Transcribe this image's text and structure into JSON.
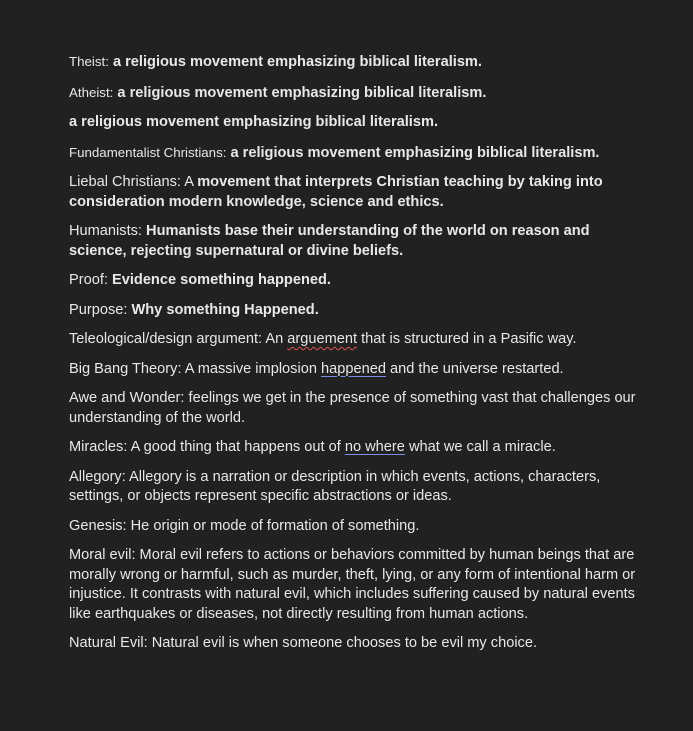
{
  "entries": [
    {
      "term": "Theist:",
      "definition": " a religious movement emphasizing biblical literalism."
    },
    {
      "term": "Atheist:",
      "definition": " a religious movement emphasizing biblical literalism."
    },
    {
      "term": "",
      "definition": "a religious movement emphasizing biblical literalism."
    },
    {
      "term": "Fundamentalist Christians:",
      "definition": " a religious movement emphasizing biblical literalism."
    },
    {
      "term": "Liebal Christians: A ",
      "definition": "movement that interprets Christian teaching by taking into consideration modern knowledge, science and ethics."
    },
    {
      "term": "Humanists: ",
      "definition": "Humanists base their understanding of the world on reason and science, rejecting supernatural or divine beliefs."
    },
    {
      "term": "Proof: ",
      "definition": "Evidence something happened."
    },
    {
      "term": "Purpose: ",
      "definition": "Why something Happened."
    },
    {
      "term": "Teleological/design argument:  An ",
      "word": "arguement",
      "rest": " that is structured in a Pasific way."
    },
    {
      "term": "Big Bang Theory: A massive implosion ",
      "word": "happened",
      "rest": " and the universe restarted."
    },
    {
      "text": "Awe and Wonder: feelings we get in the presence of something vast that challenges our understanding of the world."
    },
    {
      "term": "Miracles: A good thing that happens out of ",
      "word": "no where",
      "rest": " what we call a miracle."
    },
    {
      "text": "Allegory: Allegory is a narration or description in which events, actions, characters, settings, or objects represent specific abstractions or ideas."
    },
    {
      "text": "Genesis: He origin or mode of formation of something."
    },
    {
      "text": "Moral evil: Moral evil refers to actions or behaviors committed by human beings that are morally wrong or harmful, such as murder, theft, lying, or any form of intentional harm or injustice. It contrasts with natural evil, which includes suffering caused by natural events like earthquakes or diseases, not directly resulting from human actions."
    },
    {
      "text": "Natural Evil: Natural evil is when someone chooses to be evil my choice."
    }
  ]
}
